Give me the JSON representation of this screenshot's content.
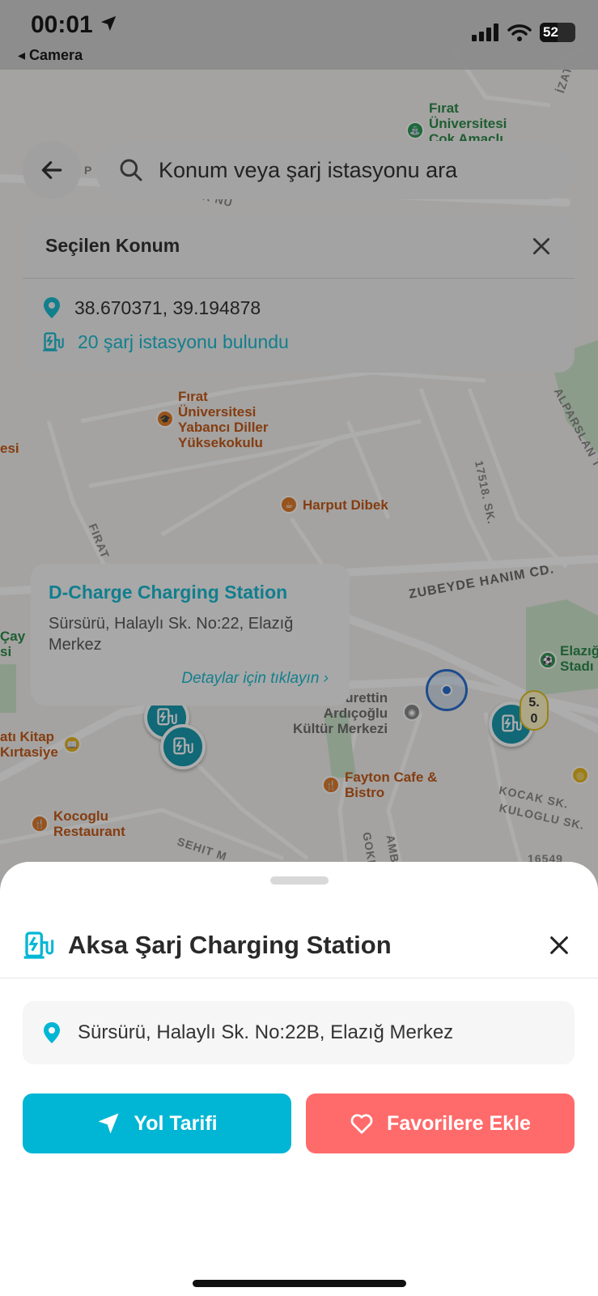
{
  "status_bar": {
    "time": "00:01",
    "back_app": "◂ Camera",
    "battery": "52"
  },
  "search": {
    "placeholder": "Konum veya şarj istasyonu ara"
  },
  "selected_location": {
    "title": "Seçilen Konum",
    "coordinates": "38.670371, 39.194878",
    "stations_found": "20 şarj istasyonu bulundu"
  },
  "map": {
    "labels": {
      "firat_uni_top": "Fırat\nÜniversitesi\nÇok Amaçlı",
      "firat_uni_school": "Fırat\nÜniversitesi\nYabancı Diller\nYüksekokulu",
      "harput_dibek": "Harput Dibek",
      "nurettin": "Nurettin\nArdıçoğlu\nKültür Merkezi",
      "fayton": "Fayton Cafe &\nBistro",
      "kocoglu": "Kocoglu\nRestaurant",
      "kitap": "atı Kitap\nKırtasiye",
      "elazig_stad": "Elazığ\nStadı",
      "esi": "esi",
      "cay": "Çay\nsi",
      "zubeyde": "ZUBEYDE HANIM CD.",
      "alparslan": "ALPARSLAN T",
      "sk17518": "17518. SK.",
      "kocak": "KOCAK SK.",
      "kuloglu": "KULOGLU SK.",
      "firat_street": "FIRAT",
      "sehit": "SEHIT M",
      "gokb": "GOKB",
      "amb": "AMB",
      "izat": "İZAT",
      "r_nu": "R NU",
      "s16549": "16549",
      "p": "P"
    },
    "cluster_value": "5.\n0",
    "popup": {
      "title": "D-Charge Charging Station",
      "address": "Sürsürü, Halaylı Sk. No:22, Elazığ Merkez",
      "link": "Detaylar için tıklayın ›"
    }
  },
  "sheet": {
    "title": "Aksa Şarj Charging Station",
    "address": "Sürsürü, Halaylı Sk. No:22B, Elazığ Merkez",
    "route_button": "Yol Tarifi",
    "favorite_button": "Favorilere Ekle"
  },
  "colors": {
    "accent": "#00b6d4",
    "favorite": "#ff6b6b",
    "teal_text": "#127f8d"
  }
}
